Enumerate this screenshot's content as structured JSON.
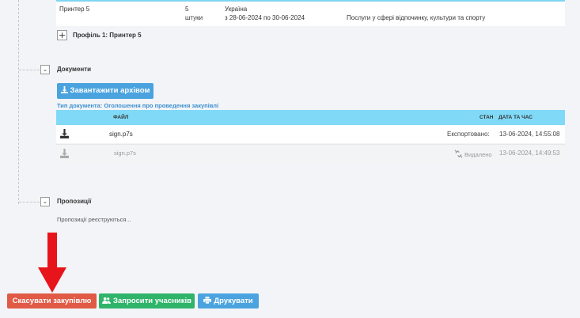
{
  "top_row": {
    "name": "Принтер 5",
    "qty_num": "5",
    "qty_unit": "штуки",
    "country": "Україна",
    "period": "з 28-06-2024 по 30-06-2024",
    "service": "Послуги у сфері відпочинку, культури та спорту"
  },
  "profile": {
    "toggle": "+",
    "label": "Профіль 1: Принтер 5"
  },
  "documents": {
    "toggle": "-",
    "title": "Документи",
    "download_archive_label": "Завантажити архівом",
    "doc_type": "Тип документа: Оголошення про проведення закупівлі",
    "columns": {
      "file": "ФАЙЛ",
      "status": "СТАН",
      "datetime": "ДАТА ТА ЧАС"
    },
    "rows": [
      {
        "file": "sign.p7s",
        "status": "Експортовано:",
        "datetime": "13-06-2024, 14:55:08"
      },
      {
        "file": "sign.p7s",
        "status": "Видалено",
        "datetime": "13-06-2024, 14:49:53"
      }
    ]
  },
  "proposals": {
    "toggle": "-",
    "title": "Пропозиції",
    "text": "Пропозиції реєструються..."
  },
  "actions": {
    "cancel_label": "Скасувати закупівлю",
    "invite_label": "Запросити учасників",
    "print_label": "Друкувати"
  },
  "colors": {
    "accent_blue": "#4aa3df",
    "header_blue": "#80daf7",
    "cancel_red": "#e05a46",
    "invite_green": "#2fb46a",
    "arrow_red": "#e8141b"
  }
}
